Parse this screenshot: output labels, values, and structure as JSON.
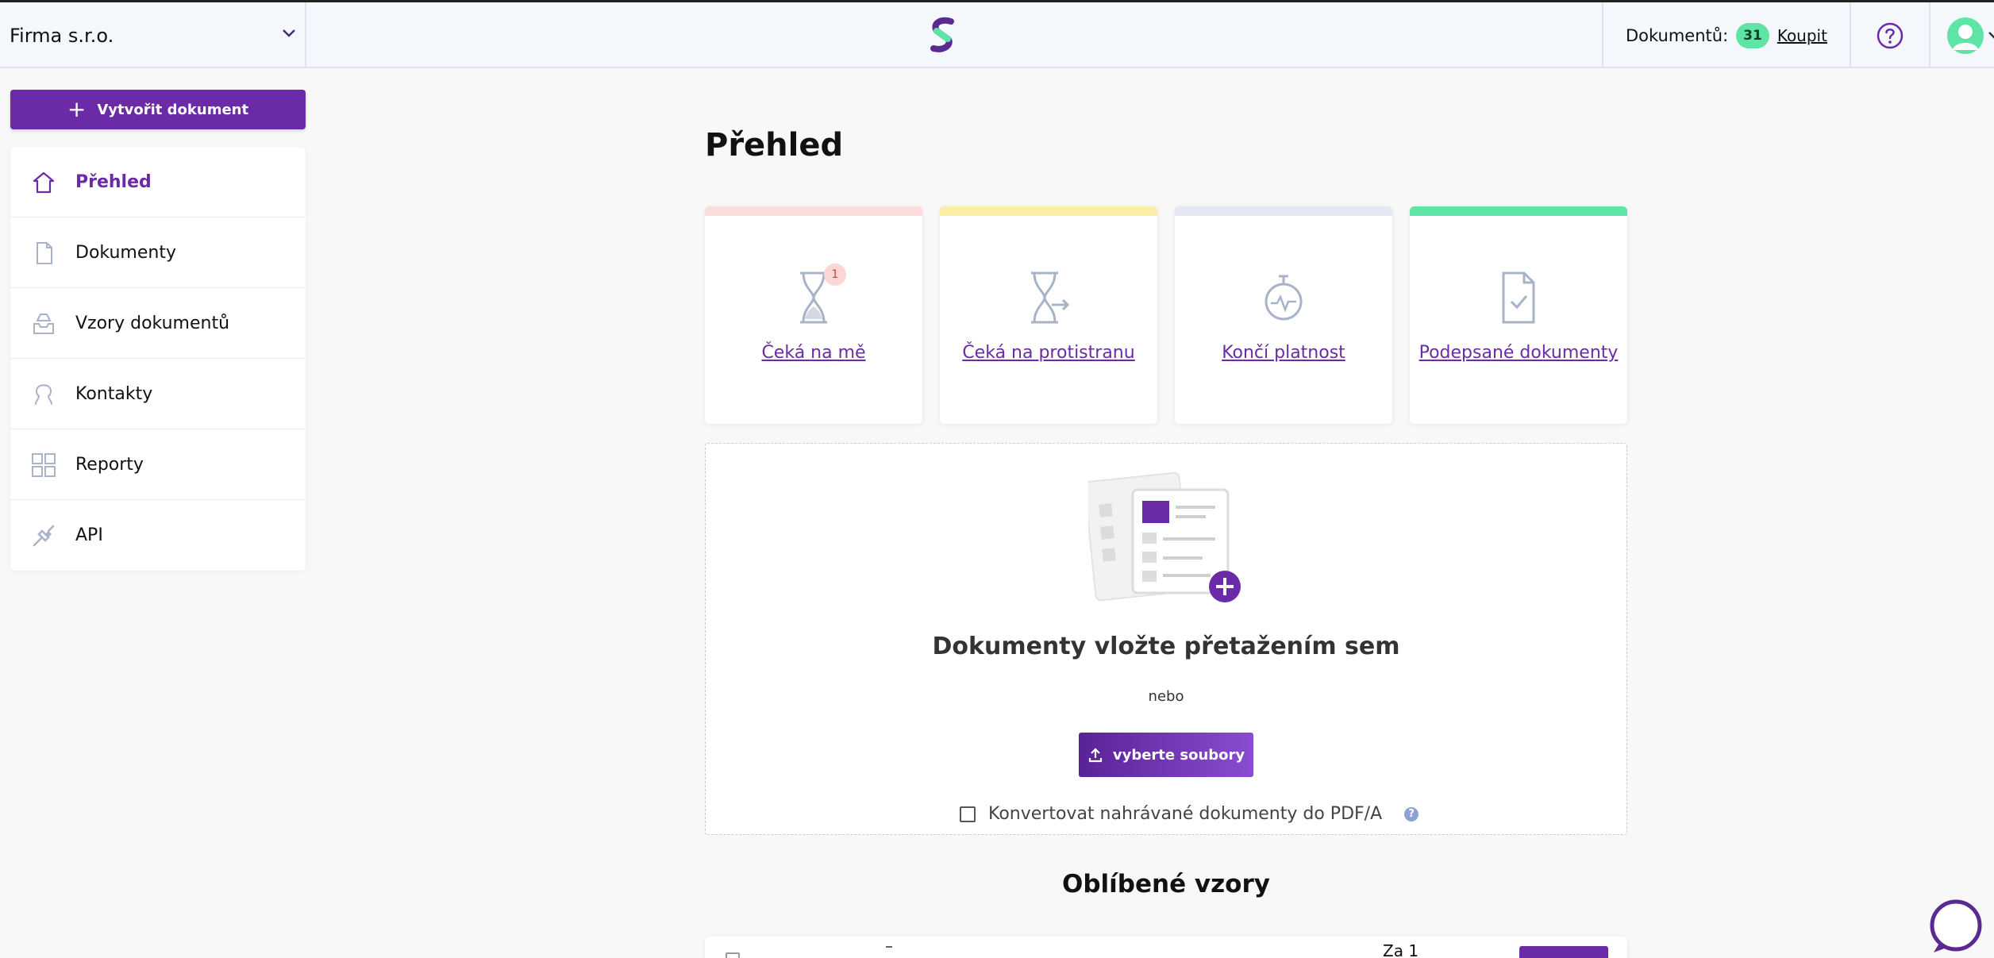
{
  "header": {
    "company_name": "Firma s.r.o.",
    "documents_label": "Dokumentů:",
    "documents_count": "31",
    "buy_link": "Koupit"
  },
  "sidebar": {
    "create_button": "Vytvořit dokument",
    "items": [
      {
        "label": "Přehled",
        "icon": "home-icon",
        "active": true
      },
      {
        "label": "Dokumenty",
        "icon": "document-icon",
        "active": false
      },
      {
        "label": "Vzory dokumentů",
        "icon": "inbox-icon",
        "active": false
      },
      {
        "label": "Kontakty",
        "icon": "contact-icon",
        "active": false
      },
      {
        "label": "Reporty",
        "icon": "grid-icon",
        "active": false
      },
      {
        "label": "API",
        "icon": "plug-icon",
        "active": false
      }
    ]
  },
  "main": {
    "title": "Přehled",
    "tiles": [
      {
        "label": "Čeká na mě",
        "badge": "1",
        "icon": "hourglass-icon",
        "color": "#fcdcdc"
      },
      {
        "label": "Čeká na protistranu",
        "icon": "hourglass-arrow-icon",
        "color": "#fbeda6"
      },
      {
        "label": "Končí platnost",
        "icon": "stopwatch-icon",
        "color": "#e3e8f2"
      },
      {
        "label": "Podepsané dokumenty",
        "icon": "signed-document-icon",
        "color": "#5ee4a5"
      }
    ],
    "dropzone": {
      "title": "Dokumenty vložte přetažením sem",
      "or_text": "nebo",
      "select_button": "vyberte soubory",
      "convert_label": "Konvertovat nahrávané dokumenty do PDF/A",
      "convert_checked": false,
      "help_icon": "?"
    },
    "favorites": {
      "title": "Oblíbené vzory",
      "peek_text": "Za 1"
    }
  },
  "colors": {
    "accent": "#6b2aa8",
    "badge_green": "#5ee4a5"
  }
}
